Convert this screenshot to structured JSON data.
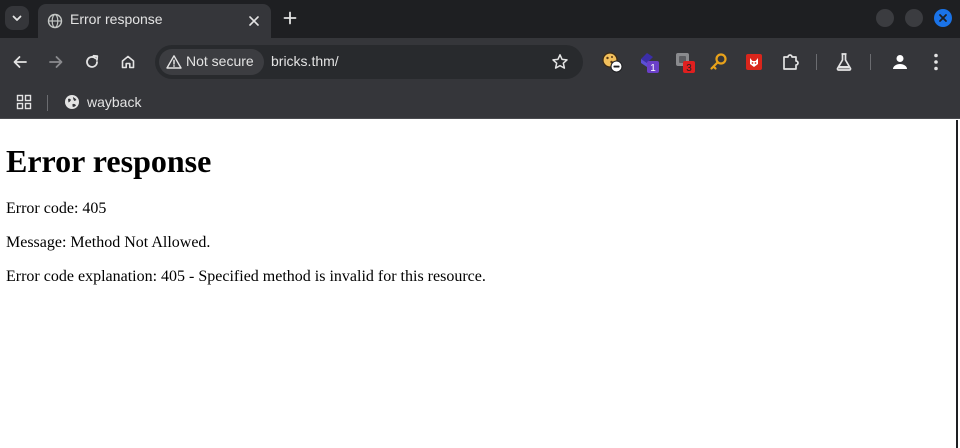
{
  "window": {
    "tab_title": "Error response",
    "colors": {
      "tab_strip": "#1e1f22",
      "toolbar": "#35363a",
      "omnibox": "#282a2d",
      "close_button": "#1a73e8"
    }
  },
  "icons": {
    "tab_search": "chevron-down-icon",
    "tab_favicon": "globe-icon",
    "tab_close": "close-icon",
    "new_tab": "plus-icon",
    "back": "back-arrow-icon",
    "forward": "forward-arrow-icon",
    "reload": "reload-icon",
    "home": "home-icon",
    "security": "warning-triangle-icon",
    "bookmark": "star-icon",
    "extensions": "puzzle-icon",
    "labs": "flask-icon",
    "profile": "person-icon",
    "menu": "kebab-menu-icon",
    "apps": "apps-grid-icon"
  },
  "omnibox": {
    "security_label": "Not secure",
    "url": "bricks.thm/"
  },
  "extensions": {
    "badge_1": "1",
    "badge_2": "3"
  },
  "bookmarks": {
    "items": [
      {
        "label": "wayback"
      }
    ]
  },
  "page": {
    "heading": "Error response",
    "error_code": "Error code: 405",
    "message": "Message: Method Not Allowed.",
    "explanation": "Error code explanation: 405 - Specified method is invalid for this resource."
  }
}
